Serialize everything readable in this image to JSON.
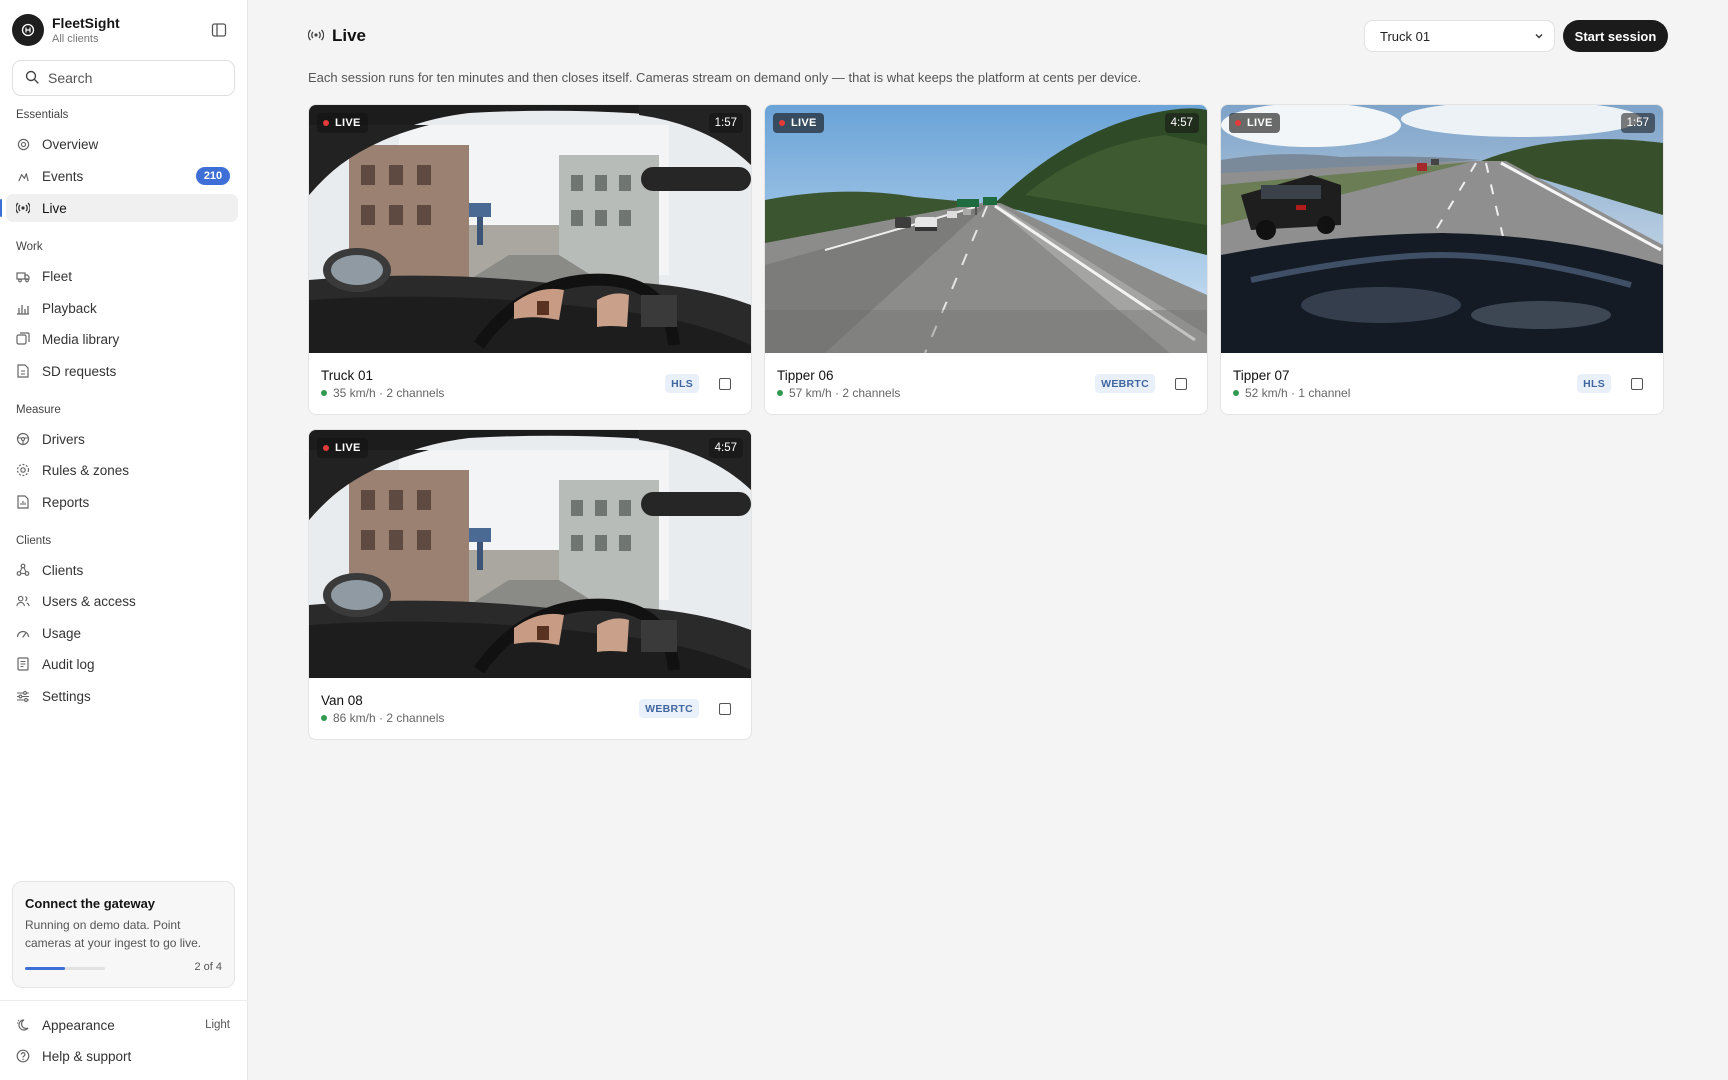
{
  "brand": {
    "name": "FleetSight",
    "subtitle": "All clients"
  },
  "search": {
    "placeholder": "Search"
  },
  "sections": {
    "essentials": "Essentials",
    "work": "Work",
    "measure": "Measure",
    "clients": "Clients"
  },
  "nav": {
    "overview": "Overview",
    "events": "Events",
    "events_badge": "210",
    "live": "Live",
    "fleet": "Fleet",
    "playback": "Playback",
    "media_library": "Media library",
    "sd_requests": "SD requests",
    "drivers": "Drivers",
    "rules_zones": "Rules & zones",
    "reports": "Reports",
    "clients": "Clients",
    "users_access": "Users & access",
    "usage": "Usage",
    "audit_log": "Audit log",
    "settings": "Settings"
  },
  "gateway": {
    "title": "Connect the gateway",
    "text": "Running on demo data. Point cameras at your ingest to go live.",
    "step": "2 of 4",
    "progress_fraction": 0.5
  },
  "footer": {
    "appearance": "Appearance",
    "appearance_value": "Light",
    "help": "Help & support"
  },
  "page": {
    "title": "Live",
    "subtitle": "Each session runs for ten minutes and then closes itself. Cameras stream on demand only — that is what keeps the platform at cents per device.",
    "vehicle_select": "Truck 01",
    "start_button": "Start session"
  },
  "live_label": "LIVE",
  "cards": [
    {
      "name": "Truck 01",
      "timer": "1:57",
      "meta": "35 km/h · 2 channels",
      "protocol": "HLS",
      "scene": "cabin"
    },
    {
      "name": "Tipper 06",
      "timer": "4:57",
      "meta": "57 km/h · 2 channels",
      "protocol": "WEBRTC",
      "scene": "highway"
    },
    {
      "name": "Tipper 07",
      "timer": "1:57",
      "meta": "52 km/h · 1 channel",
      "protocol": "HLS",
      "scene": "hood"
    },
    {
      "name": "Van 08",
      "timer": "4:57",
      "meta": "86 km/h · 2 channels",
      "protocol": "WEBRTC",
      "scene": "cabin"
    }
  ],
  "colors": {
    "accent": "#3d6fd6",
    "live_dot": "#e43a3a",
    "status_dot": "#2f9a4f"
  }
}
